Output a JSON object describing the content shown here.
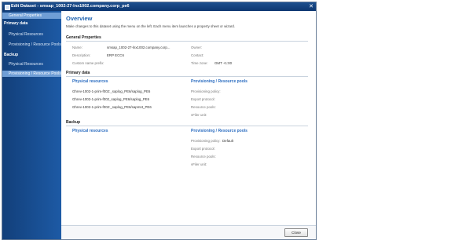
{
  "window": {
    "title": "Edit Dataset - smsap_1002-27-lnx1002.company.corp_pe6",
    "close_glyph": "✕"
  },
  "sidebar": {
    "general": "General Properties",
    "primary_header": "Primary data",
    "primary_items": [
      "Physical Resources",
      "Provisioning / Resource Pools"
    ],
    "backup_header": "Backup",
    "backup_items": [
      "Physical Resources",
      "Provisioning / Resource Pools"
    ]
  },
  "main": {
    "title": "Overview",
    "description": "Make changes to this dataset using the menu on the left. Each menu item launches a property sheet or wizard.",
    "general": {
      "header": "General Properties",
      "name_label": "Name:",
      "name_value": "smsap_1002-27-lnx1002.company.corp...",
      "description_label": "Description:",
      "description_value": "ERP ECC6",
      "prefix_label": "Custom name prefix:",
      "prefix_value": "",
      "owner_label": "Owner:",
      "owner_value": "",
      "contact_label": "Contact:",
      "contact_value": "",
      "timezone_label": "Time zone:",
      "timezone_value": "GMT +1:00"
    },
    "primary": {
      "header": "Primary data",
      "physical_title": "Physical resources",
      "physical_items": [
        "Ghrev-1002-1-prim-f002:_saplog_PE6/saplog_PE6",
        "Ghrev-1002-1-prim-f002_saplog_PE6/saplog_PE6",
        "Ghrev-1002-1-prim-f002:_saplog_PE6/sapmnt_PE6"
      ],
      "prov_title": "Provisioning / Resource pools",
      "prov_labels": [
        "Provisioning policy:",
        "Export protocol:",
        "Resource pools:",
        "vFiler unit:"
      ]
    },
    "backup": {
      "header": "Backup",
      "physical_title": "Physical resources",
      "prov_title": "Provisioning / Resource pools",
      "prov_labels": [
        "Provisioning policy:",
        "Export protocol:",
        "Resource pools:",
        "vFiler unit:"
      ],
      "policy_value": "Default"
    }
  },
  "footer": {
    "close_label": "Close"
  }
}
